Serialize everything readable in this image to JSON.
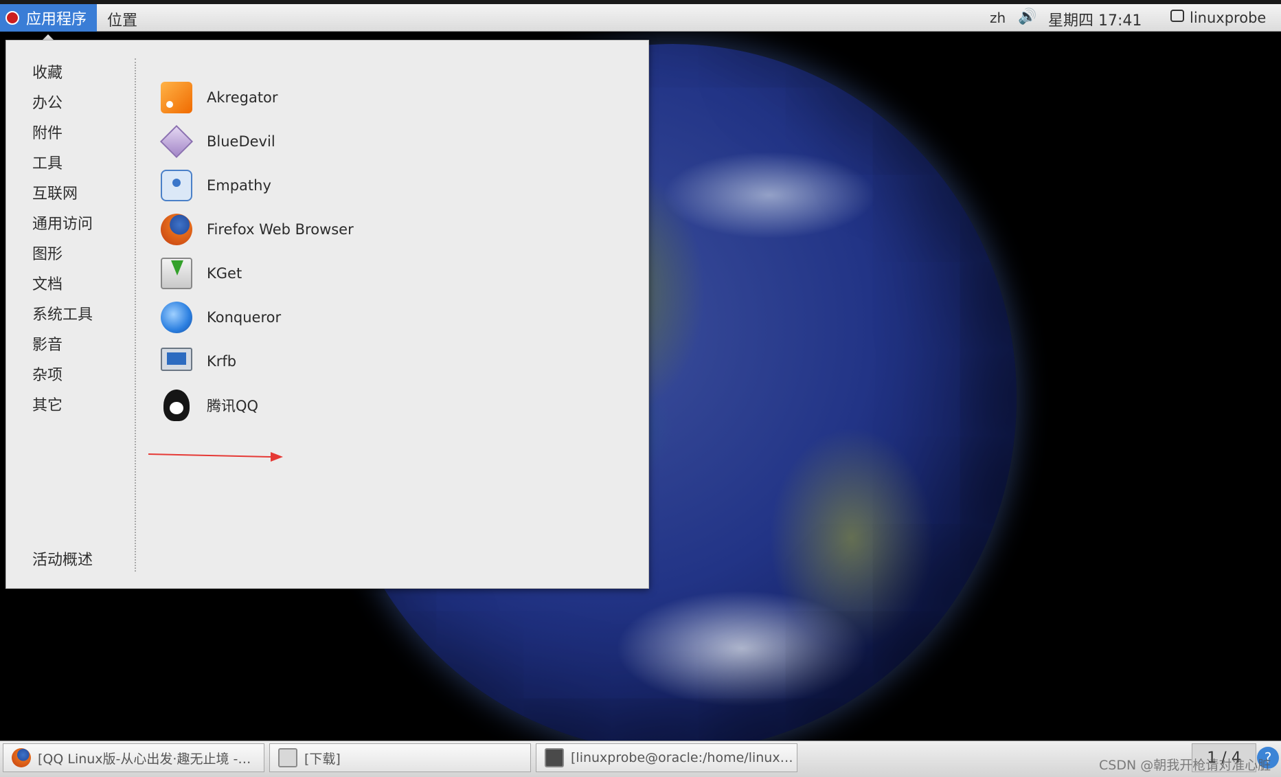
{
  "topbar": {
    "applications_label": "应用程序",
    "places_label": "位置",
    "input_language": "zh",
    "clock": "星期四 17:41",
    "username": "linuxprobe"
  },
  "menu": {
    "categories": [
      "收藏",
      "办公",
      "附件",
      "工具",
      "互联网",
      "通用访问",
      "图形",
      "文档",
      "系统工具",
      "影音",
      "杂项",
      "其它"
    ],
    "activities_label": "活动概述",
    "apps": [
      {
        "label": "Akregator",
        "icon": "rss-reader-icon"
      },
      {
        "label": "BlueDevil",
        "icon": "bluetooth-diamond-icon"
      },
      {
        "label": "Empathy",
        "icon": "chat-bubble-icon"
      },
      {
        "label": "Firefox Web Browser",
        "icon": "firefox-icon"
      },
      {
        "label": "KGet",
        "icon": "download-manager-icon"
      },
      {
        "label": "Konqueror",
        "icon": "konqueror-globe-icon"
      },
      {
        "label": "Krfb",
        "icon": "desktop-sharing-icon"
      },
      {
        "label": "腾讯QQ",
        "icon": "qq-penguin-icon"
      }
    ]
  },
  "taskbar": {
    "windows": [
      {
        "label": "[QQ Linux版-从心出发·趣无止境 -…",
        "icon": "firefox-icon"
      },
      {
        "label": "[下载]",
        "icon": "folder-icon"
      },
      {
        "label": "[linuxprobe@oracle:/home/linux…",
        "icon": "terminal-icon"
      }
    ],
    "workspace": "1 / 4"
  },
  "watermark": "CSDN @朝我开枪请对准心脏",
  "colors": {
    "accent": "#3a7dd6",
    "annotation_arrow": "#e53935"
  }
}
